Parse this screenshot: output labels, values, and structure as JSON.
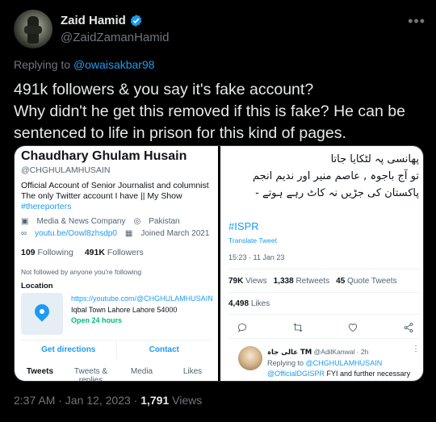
{
  "author": {
    "display_name": "Zaid Hamid",
    "handle": "@ZaidZamanHamid"
  },
  "replying": {
    "prefix": "Replying to",
    "mention": "@owaisakbar98"
  },
  "tweet": {
    "line1": "491k followers & you say it's fake account?",
    "line2": "Why didn't he get this removed if this is fake? He can be sentenced to life in prison for this kind of pages."
  },
  "media_left": {
    "name": "Chaudhary Ghulam Husain",
    "handle": "@CHGHULAMHUSAIN",
    "bio1": "Official Account of Senior Journalist and columnist",
    "bio2": "The only Twitter account I have || My Show",
    "hashtag": "#thereporters",
    "category": "Media & News Company",
    "location": "Pakistan",
    "link": "youtu.be/Oowl8zhsdp0",
    "joined": "Joined March 2021",
    "following_count": "109",
    "following_label": "Following",
    "followers_count": "491K",
    "followers_label": "Followers",
    "not_followed": "Not followed by anyone you're following",
    "location_heading": "Location",
    "loc_url": "https://youtube.com/@CHGHULAMHUSAIN",
    "loc_address": "Iqbal Town Lahore Lahore 54000",
    "loc_open": "Open 24 hours",
    "btn_directions": "Get directions",
    "btn_contact": "Contact",
    "tabs": [
      "Tweets",
      "Tweets & replies",
      "Media",
      "Likes"
    ]
  },
  "media_right": {
    "urdu_line1": "پھانسی پہ لٹکایا جاتا",
    "urdu_line2": "تو آج باجوہ , عاصم منیر اور ندیم انجم",
    "urdu_line3": "پاکستان کی جڑیں نہ کاٹ رہے ہوتے -",
    "hashtag": "#ISPR",
    "translate": "Translate Tweet",
    "timestamp": "15:23 · 11 Jan 23",
    "views_count": "79K",
    "views_label": "Views",
    "retweets_count": "1,338",
    "retweets_label": "Retweets",
    "quotes_count": "45",
    "quotes_label": "Quote Tweets",
    "likes_count": "4,498",
    "likes_label": "Likes",
    "reply_name": "عالی جاہ TM",
    "reply_handle": "@AdilKanwal · 2h",
    "reply_to_prefix": "Replying to",
    "reply_to_mention": "@CHGHULAMHUSAIN",
    "reply_mention": "@OfficialDGISPR",
    "reply_text": "FYI and further necessary"
  },
  "footer": {
    "time": "2:37 AM · Jan 12, 2023 · ",
    "views_count": "1,791",
    "views_label": "Views"
  }
}
